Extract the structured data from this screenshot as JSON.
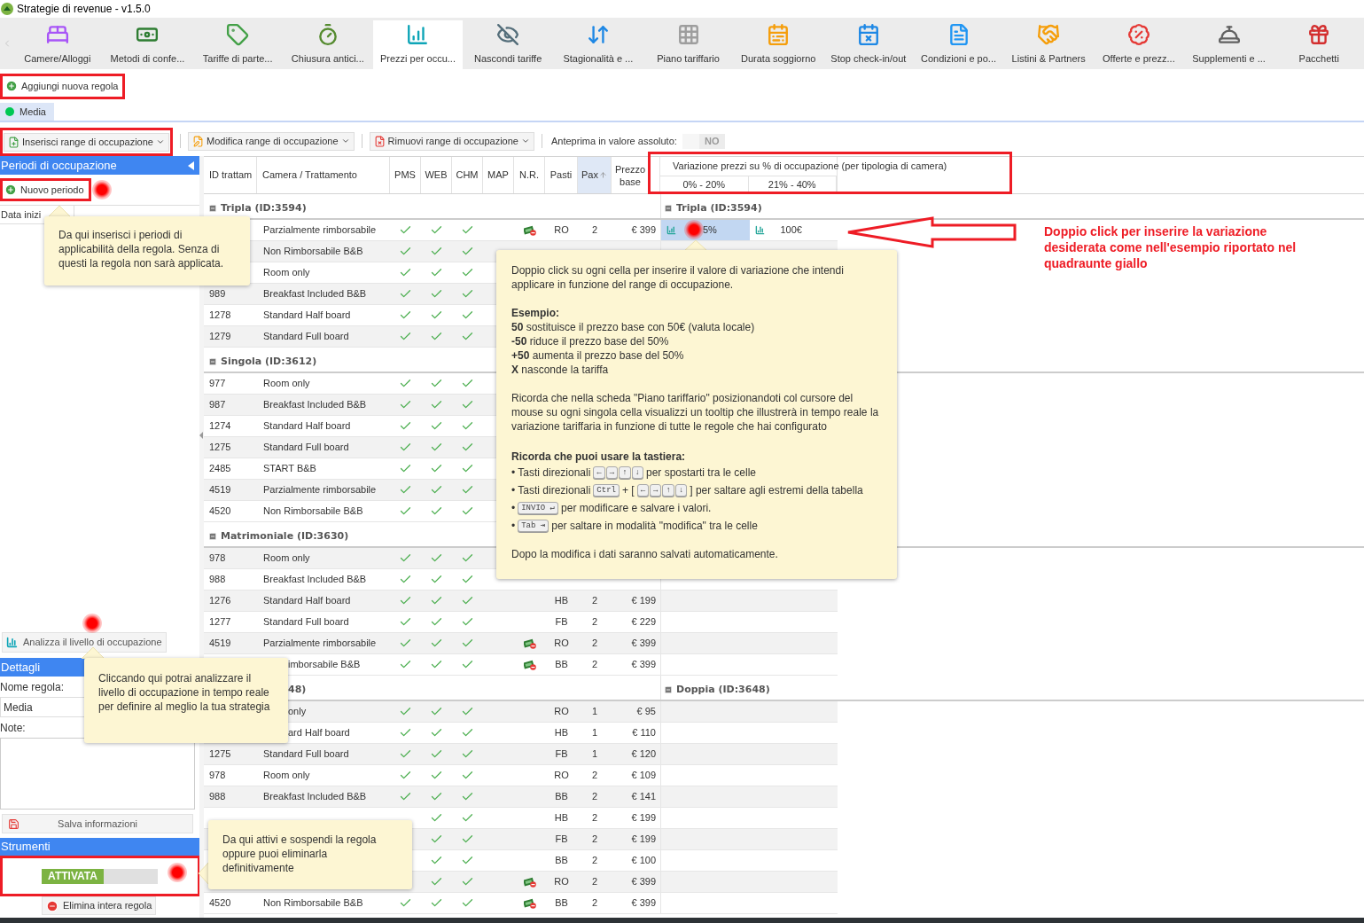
{
  "window": {
    "title": "Strategie di revenue - v1.5.0"
  },
  "ribbon": {
    "tabs": [
      {
        "label": "Camere/Alloggi",
        "selected": false
      },
      {
        "label": "Metodi di confe...",
        "selected": false
      },
      {
        "label": "Tariffe di parte...",
        "selected": false
      },
      {
        "label": "Chiusura antici...",
        "selected": false
      },
      {
        "label": "Prezzi per occu...",
        "selected": true
      },
      {
        "label": "Nascondi tariffe",
        "selected": false
      },
      {
        "label": "Stagionalità e ...",
        "selected": false
      },
      {
        "label": "Piano tariffario",
        "selected": false
      },
      {
        "label": "Durata soggiorno",
        "selected": false
      },
      {
        "label": "Stop check-in/out",
        "selected": false
      },
      {
        "label": "Condizioni e po...",
        "selected": false
      },
      {
        "label": "Listini & Partners",
        "selected": false
      },
      {
        "label": "Offerte e prezz...",
        "selected": false
      },
      {
        "label": "Supplementi e ...",
        "selected": false
      },
      {
        "label": "Pacchetti",
        "selected": false
      }
    ]
  },
  "add_rule_button": "Aggiungi nuova regola",
  "rule_tabs": [
    {
      "label": "Media",
      "selected": true
    }
  ],
  "toolbar": {
    "buttons": [
      "Inserisci range di occupazione",
      "Modifica range di occupazione",
      "Rimuovi range di occupazione"
    ],
    "preview_label": "Anteprima in valore assoluto:",
    "preview_toggle": {
      "label": "NO",
      "on": false
    }
  },
  "periods_panel": {
    "title": "Periodi di occupazione",
    "new_button": "Nuovo periodo",
    "columns": [
      "Data inizi"
    ],
    "analyze_button": "Analizza il livello di occupazione"
  },
  "details": {
    "title": "Dettagli",
    "name_label": "Nome regola:",
    "name_value": "Media",
    "notes_label": "Note:",
    "save_button": "Salva informazioni"
  },
  "tools": {
    "title": "Strumenti",
    "status_toggle": {
      "label": "ATTIVATA",
      "on": true
    },
    "delete_button": "Elimina intera regola"
  },
  "grid": {
    "columns": [
      {
        "label": "ID trattam",
        "sorted": false
      },
      {
        "label": "Camera / Trattamento",
        "sorted": false
      },
      {
        "label": "PMS",
        "sorted": false
      },
      {
        "label": "WEB",
        "sorted": false
      },
      {
        "label": "CHM",
        "sorted": false
      },
      {
        "label": "MAP",
        "sorted": false
      },
      {
        "label": "N.R.",
        "sorted": false
      },
      {
        "label": "Pasti",
        "sorted": false
      },
      {
        "label": "Pax",
        "sorted": true
      },
      {
        "label": "Prezzo base",
        "sorted": false
      }
    ],
    "variation_header": "Variazione prezzi su % di occupazione (per tipologia di camera)",
    "ranges": [
      "0% - 20%",
      "21% - 40%"
    ],
    "groups": [
      {
        "title": "Tripla (ID:3594)",
        "right_title": "Tripla (ID:3594)",
        "rows": [
          {
            "name": "Parzialmente rimborsabile",
            "pms": true,
            "web": true,
            "chm": true,
            "nr": true,
            "meal": "RO",
            "pax": "2",
            "price": "€ 399",
            "variations": [
              {
                "text": "5%",
                "selected": true
              },
              {
                "text": "100€",
                "selected": false
              }
            ]
          },
          {
            "name": "Non Rimborsabile B&B",
            "pms": true,
            "web": true,
            "chm": true
          },
          {
            "name": "Room only",
            "pms": true,
            "web": true,
            "chm": true
          },
          {
            "id": "989",
            "name": "Breakfast Included B&B",
            "pms": true,
            "web": true,
            "chm": true
          },
          {
            "id": "1278",
            "name": "Standard Half board",
            "pms": true,
            "web": true,
            "chm": true
          },
          {
            "id": "1279",
            "name": "Standard Full board",
            "pms": true,
            "web": true,
            "chm": true
          }
        ]
      },
      {
        "title": "Singola (ID:3612)",
        "rows": [
          {
            "id": "977",
            "name": "Room only",
            "pms": true,
            "web": true,
            "chm": true
          },
          {
            "id": "987",
            "name": "Breakfast Included B&B",
            "pms": true,
            "web": true,
            "chm": true
          },
          {
            "id": "1274",
            "name": "Standard Half board",
            "pms": true,
            "web": true,
            "chm": true
          },
          {
            "id": "1275",
            "name": "Standard Full board",
            "pms": true,
            "web": true,
            "chm": true
          },
          {
            "id": "2485",
            "name": "START B&B",
            "pms": true,
            "web": true,
            "chm": true
          },
          {
            "id": "4519",
            "name": "Parzialmente rimborsabile",
            "pms": true,
            "web": true,
            "chm": true
          },
          {
            "id": "4520",
            "name": "Non Rimborsabile B&B",
            "pms": true,
            "web": true,
            "chm": true
          }
        ]
      },
      {
        "title": "Matrimoniale (ID:3630)",
        "rows": [
          {
            "id": "978",
            "name": "Room only",
            "pms": true,
            "web": true,
            "chm": true
          },
          {
            "id": "988",
            "name": "Breakfast Included B&B",
            "pms": true,
            "web": true,
            "chm": true
          },
          {
            "id": "1276",
            "name": "Standard Half board",
            "pms": true,
            "web": true,
            "chm": true,
            "meal": "HB",
            "pax": "2",
            "price": "€ 199"
          },
          {
            "id": "1277",
            "name": "Standard Full board",
            "pms": true,
            "web": true,
            "chm": true,
            "meal": "FB",
            "pax": "2",
            "price": "€ 229"
          },
          {
            "id": "4519",
            "name": "Parzialmente rimborsabile",
            "pms": true,
            "web": true,
            "chm": true,
            "nr": true,
            "meal": "RO",
            "pax": "2",
            "price": "€ 399"
          },
          {
            "name": "imborsabile B&B",
            "name_cut": true,
            "pms": true,
            "web": true,
            "chm": true,
            "nr": true,
            "meal": "BB",
            "pax": "2",
            "price": "€ 399"
          }
        ]
      },
      {
        "title": "48)",
        "title_cut": true,
        "right_title": "Doppia (ID:3648)",
        "rows": [
          {
            "name": "only",
            "name_cut": true,
            "pms": true,
            "web": true,
            "chm": true,
            "meal": "RO",
            "pax": "1",
            "price": "€ 95"
          },
          {
            "name": "ard Half board",
            "name_cut": true,
            "pms": true,
            "web": true,
            "chm": true,
            "meal": "HB",
            "pax": "1",
            "price": "€ 110"
          },
          {
            "id": "1275",
            "name": "Standard Full board",
            "pms": true,
            "web": true,
            "chm": true,
            "meal": "FB",
            "pax": "1",
            "price": "€ 120"
          },
          {
            "id": "978",
            "name": "Room only",
            "pms": true,
            "web": true,
            "chm": true,
            "meal": "RO",
            "pax": "2",
            "price": "€ 109"
          },
          {
            "id": "988",
            "name": "Breakfast Included B&B",
            "pms": true,
            "web": true,
            "chm": true,
            "meal": "BB",
            "pax": "2",
            "price": "€ 141"
          },
          {
            "web": true,
            "chm": true,
            "meal": "HB",
            "pax": "2",
            "price": "€ 199"
          },
          {
            "web": true,
            "chm": true,
            "meal": "FB",
            "pax": "2",
            "price": "€ 199"
          },
          {
            "web": true,
            "chm": true,
            "meal": "BB",
            "pax": "2",
            "price": "€ 100"
          },
          {
            "web": true,
            "chm": true,
            "nr": true,
            "meal": "RO",
            "pax": "2",
            "price": "€ 399"
          },
          {
            "id": "4520",
            "name": "Non Rimborsabile B&B",
            "pms": true,
            "web": true,
            "chm": true,
            "nr": true,
            "meal": "BB",
            "pax": "2",
            "price": "€ 399"
          }
        ]
      }
    ]
  },
  "callouts": [
    "Da qui inserisci i periodi di applicabilità della regola. Senza di questi la regola non sarà applicata.",
    "Cliccando qui potrai analizzare il livello di occupazione in tempo reale per definire al meglio la tua strategia",
    "Da qui attivi e sospendi la regola oppure puoi eliminarla definitivamente"
  ],
  "help_tooltip": {
    "intro": "Doppio click su ogni cella per inserire il valore di variazione che intendi applicare in funzione del range di occupazione.",
    "example_title": "Esempio:",
    "examples": [
      "**50** sostituisce il prezzo base con 50€ (valuta locale)",
      "**-50** riduce il prezzo base del 50%",
      "**+50** aumenta il prezzo base del 50%",
      "**X** nasconde la tariffa"
    ],
    "reminder": "Ricorda che nella scheda \"Piano tariffario\" posizionandoti col cursore del mouse su ogni singola cella visualizzi un tooltip che illustrerà in tempo reale la variazione tariffaria in funzione di tutte le regole che hai configurato",
    "keyboard_title": "Ricorda che puoi usare la tastiera:",
    "keyboard": [
      [
        {
          "text": "• Tasti direzionali"
        },
        {
          "keys": [
            "←",
            "→",
            "↑",
            "↓"
          ]
        },
        {
          "text": "per spostarti tra le celle"
        }
      ],
      [
        {
          "text": "• Tasti direzionali"
        },
        {
          "keys": [
            "Ctrl"
          ]
        },
        {
          "text": "+ ["
        },
        {
          "keys": [
            "←",
            "→",
            "↑",
            "↓"
          ]
        },
        {
          "text": "] per saltare agli estremi della tabella"
        }
      ],
      [
        {
          "text": "•"
        },
        {
          "keys": [
            "INVIO ↵"
          ]
        },
        {
          "text": "per modificare e salvare i valori."
        }
      ],
      [
        {
          "text": "•"
        },
        {
          "keys": [
            "Tab ⇥"
          ]
        },
        {
          "text": "per saltare in modalità \"modifica\" tra le celle"
        }
      ]
    ],
    "footer": "Dopo la modifica i dati saranno salvati automaticamente."
  },
  "annotation": "Doppio click per inserire la variazione desiderata come nell'esempio riportato nel quadraunte giallo"
}
